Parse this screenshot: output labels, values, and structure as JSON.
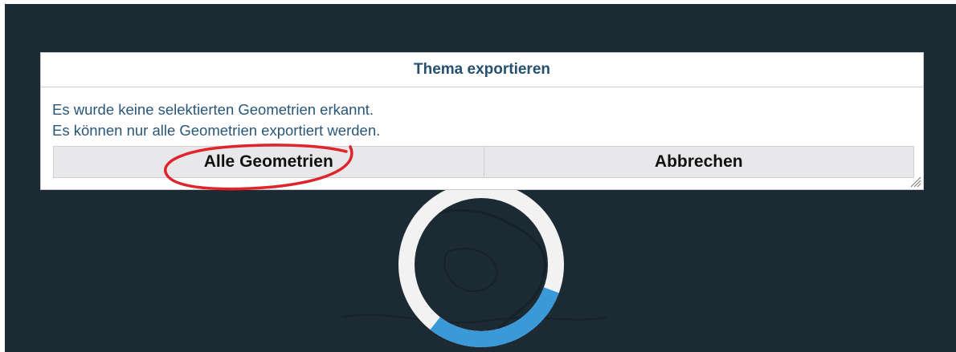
{
  "dialog": {
    "title": "Thema exportieren",
    "message_line1": "Es wurde keine selektierten Geometrien erkannt.",
    "message_line2": "Es können nur alle Geometrien exportiert werden.",
    "buttons": {
      "all_geometries": "Alle Geometrien",
      "cancel": "Abbrechen"
    }
  },
  "loading": {
    "progress_fraction": 0.3
  },
  "colors": {
    "background": "#1c2a33",
    "dialog_title": "#25506e",
    "message_text": "#2a5778",
    "button_bg": "#e8e8ea",
    "spinner_track": "#f2f2f2",
    "spinner_arc": "#3a99d8",
    "annotation": "#e0242c"
  }
}
